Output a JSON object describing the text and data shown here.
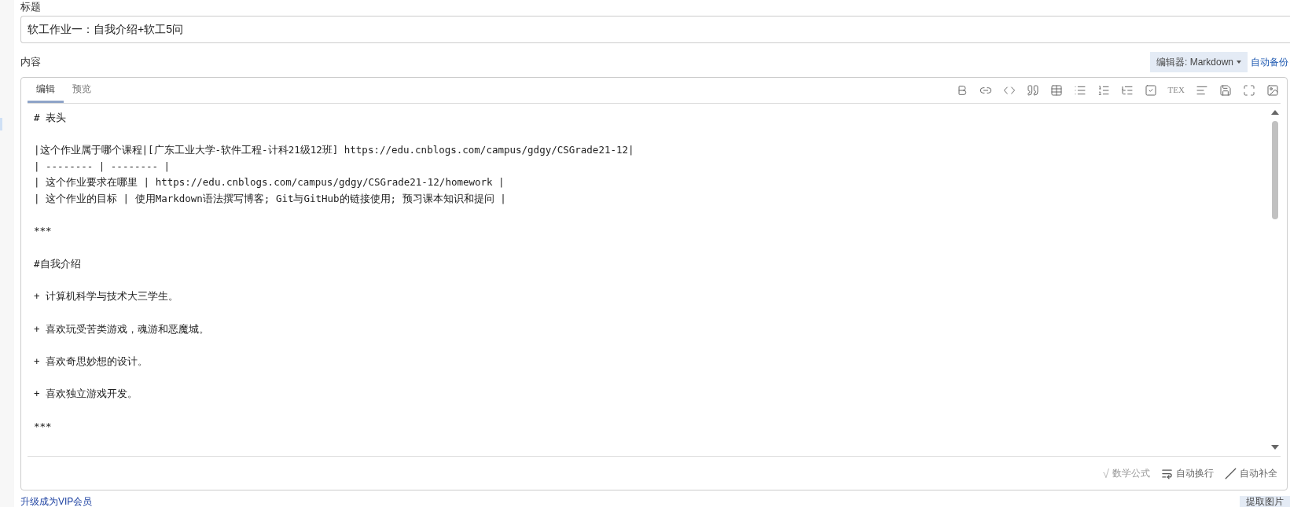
{
  "title_field": {
    "label": "标题",
    "value": "软工作业一：自我介绍+软工5问"
  },
  "content": {
    "label": "内容",
    "editor_button": "编辑器: Markdown",
    "autosave_link": "自动备份"
  },
  "tabs": [
    {
      "label": "编辑",
      "selected": true
    },
    {
      "label": "预览",
      "selected": false
    }
  ],
  "toolbar": {
    "formula_button": "TEX"
  },
  "code_blocks": [
    [
      "# 表头"
    ],
    [
      "|这个作业属于哪个课程|[广东工业大学-软件工程-计科21级12班] https://edu.cnblogs.com/campus/gdgy/CSGrade21-12|",
      "| -------- | -------- |",
      "| 这个作业要求在哪里 | https://edu.cnblogs.com/campus/gdgy/CSGrade21-12/homework |",
      "| 这个作业的目标 | 使用Markdown语法撰写博客; Git与GitHub的链接使用; 预习课本知识和提问 |"
    ],
    [
      "***"
    ],
    [
      "#自我介绍"
    ],
    [
      "+ 计算机科学与技术大三学生。"
    ],
    [
      "+ 喜欢玩受苦类游戏，魂游和恶魔城。"
    ],
    [
      "+ 喜欢奇思妙想的设计。"
    ],
    [
      "+ 喜欢独立游戏开发。"
    ],
    [
      "***"
    ]
  ],
  "footer_options": [
    {
      "kind": "formula",
      "glyph": "√",
      "label": "数学公式",
      "on": false
    },
    {
      "kind": "wrap",
      "label": "自动换行",
      "on": true
    },
    {
      "kind": "autocomplete",
      "label": "自动补全",
      "on": true
    }
  ],
  "bottom": {
    "vip_link": "升级成为VIP会员",
    "extract_button": "提取图片"
  }
}
